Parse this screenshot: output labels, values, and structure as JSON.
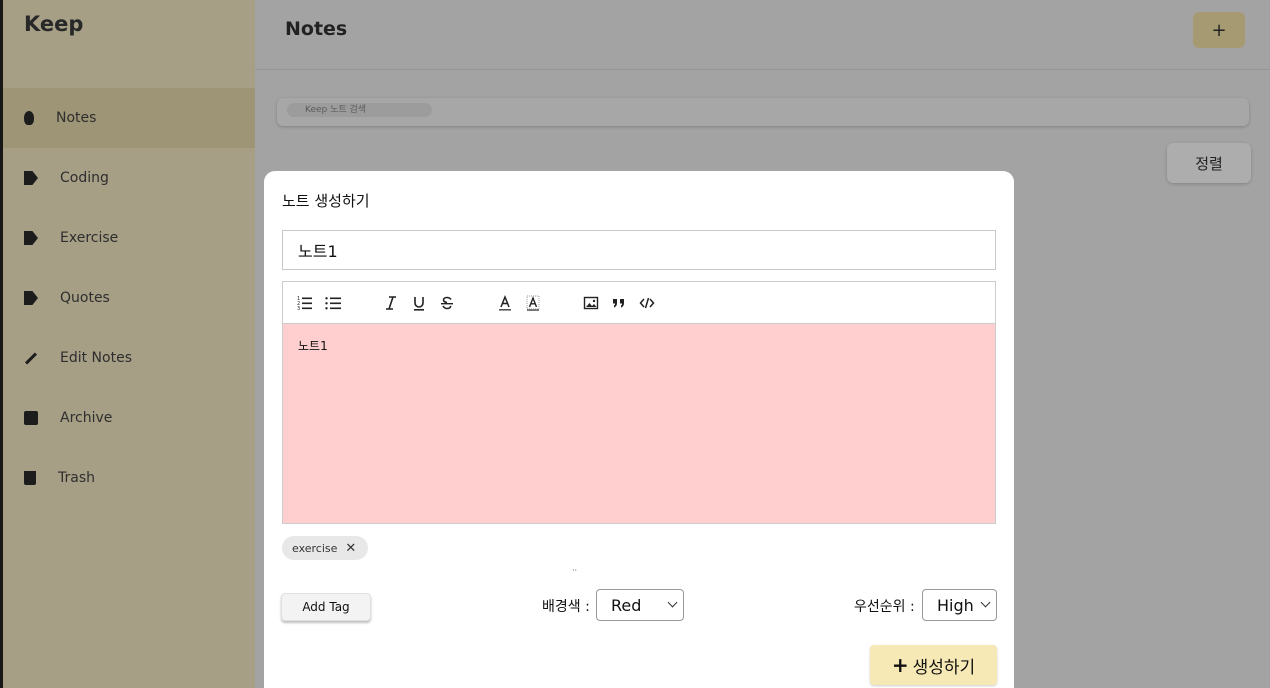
{
  "background": {
    "app_name": "Keep",
    "page_title": "Notes",
    "add_button": "+",
    "search_placeholder": "Keep 노트 검색",
    "sort_button": "정렬",
    "sidebar_items": [
      {
        "label": "Notes",
        "icon": "pin-icon"
      },
      {
        "label": "Coding",
        "icon": "tag-icon"
      },
      {
        "label": "Exercise",
        "icon": "tag-icon"
      },
      {
        "label": "Quotes",
        "icon": "tag-icon"
      },
      {
        "label": "Edit Notes",
        "icon": "pencil-icon"
      },
      {
        "label": "Archive",
        "icon": "archive-icon"
      },
      {
        "label": "Trash",
        "icon": "trash-icon"
      }
    ]
  },
  "modal": {
    "title": "노트 생성하기",
    "note_title_value": "노트1",
    "toolbar_icons": [
      "ordered-list-icon",
      "bullet-list-icon",
      "italic-icon",
      "underline-icon",
      "strikethrough-icon",
      "font-color-icon",
      "background-color-icon",
      "image-icon",
      "quote-icon",
      "code-icon"
    ],
    "editor_content": "노트1",
    "editor_background": "#ffcece",
    "tags": [
      {
        "label": "exercise",
        "remove": "✕"
      }
    ],
    "add_tag_label": "Add Tag",
    "color_label": "배경색 :",
    "color_value": "Red",
    "priority_label": "우선순위 :",
    "priority_value": "High",
    "create_plus": "+",
    "create_label": "생성하기"
  },
  "colors": {
    "sidebar": "#f5eac6",
    "accent": "#f6e9b5",
    "overlay": "rgba(0,0,0,0.32)"
  }
}
